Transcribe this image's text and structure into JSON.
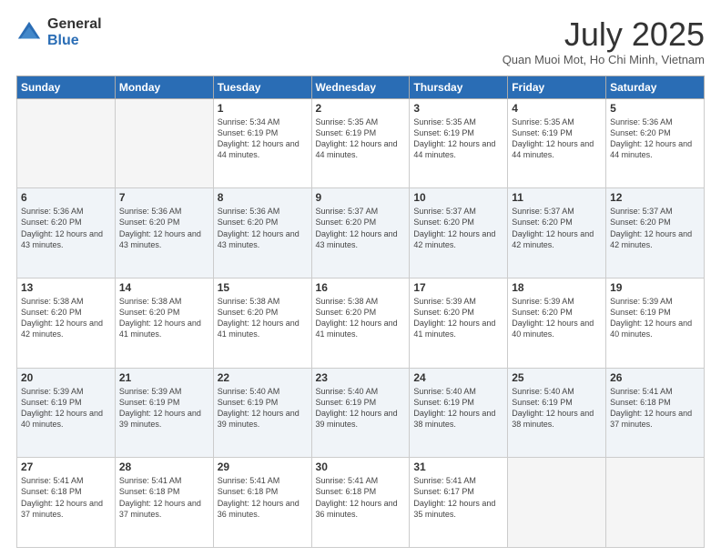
{
  "logo": {
    "general": "General",
    "blue": "Blue"
  },
  "title": "July 2025",
  "subtitle": "Quan Muoi Mot, Ho Chi Minh, Vietnam",
  "weekdays": [
    "Sunday",
    "Monday",
    "Tuesday",
    "Wednesday",
    "Thursday",
    "Friday",
    "Saturday"
  ],
  "weeks": [
    [
      {
        "day": "",
        "info": ""
      },
      {
        "day": "",
        "info": ""
      },
      {
        "day": "1",
        "info": "Sunrise: 5:34 AM\nSunset: 6:19 PM\nDaylight: 12 hours and 44 minutes."
      },
      {
        "day": "2",
        "info": "Sunrise: 5:35 AM\nSunset: 6:19 PM\nDaylight: 12 hours and 44 minutes."
      },
      {
        "day": "3",
        "info": "Sunrise: 5:35 AM\nSunset: 6:19 PM\nDaylight: 12 hours and 44 minutes."
      },
      {
        "day": "4",
        "info": "Sunrise: 5:35 AM\nSunset: 6:19 PM\nDaylight: 12 hours and 44 minutes."
      },
      {
        "day": "5",
        "info": "Sunrise: 5:36 AM\nSunset: 6:20 PM\nDaylight: 12 hours and 44 minutes."
      }
    ],
    [
      {
        "day": "6",
        "info": "Sunrise: 5:36 AM\nSunset: 6:20 PM\nDaylight: 12 hours and 43 minutes."
      },
      {
        "day": "7",
        "info": "Sunrise: 5:36 AM\nSunset: 6:20 PM\nDaylight: 12 hours and 43 minutes."
      },
      {
        "day": "8",
        "info": "Sunrise: 5:36 AM\nSunset: 6:20 PM\nDaylight: 12 hours and 43 minutes."
      },
      {
        "day": "9",
        "info": "Sunrise: 5:37 AM\nSunset: 6:20 PM\nDaylight: 12 hours and 43 minutes."
      },
      {
        "day": "10",
        "info": "Sunrise: 5:37 AM\nSunset: 6:20 PM\nDaylight: 12 hours and 42 minutes."
      },
      {
        "day": "11",
        "info": "Sunrise: 5:37 AM\nSunset: 6:20 PM\nDaylight: 12 hours and 42 minutes."
      },
      {
        "day": "12",
        "info": "Sunrise: 5:37 AM\nSunset: 6:20 PM\nDaylight: 12 hours and 42 minutes."
      }
    ],
    [
      {
        "day": "13",
        "info": "Sunrise: 5:38 AM\nSunset: 6:20 PM\nDaylight: 12 hours and 42 minutes."
      },
      {
        "day": "14",
        "info": "Sunrise: 5:38 AM\nSunset: 6:20 PM\nDaylight: 12 hours and 41 minutes."
      },
      {
        "day": "15",
        "info": "Sunrise: 5:38 AM\nSunset: 6:20 PM\nDaylight: 12 hours and 41 minutes."
      },
      {
        "day": "16",
        "info": "Sunrise: 5:38 AM\nSunset: 6:20 PM\nDaylight: 12 hours and 41 minutes."
      },
      {
        "day": "17",
        "info": "Sunrise: 5:39 AM\nSunset: 6:20 PM\nDaylight: 12 hours and 41 minutes."
      },
      {
        "day": "18",
        "info": "Sunrise: 5:39 AM\nSunset: 6:20 PM\nDaylight: 12 hours and 40 minutes."
      },
      {
        "day": "19",
        "info": "Sunrise: 5:39 AM\nSunset: 6:19 PM\nDaylight: 12 hours and 40 minutes."
      }
    ],
    [
      {
        "day": "20",
        "info": "Sunrise: 5:39 AM\nSunset: 6:19 PM\nDaylight: 12 hours and 40 minutes."
      },
      {
        "day": "21",
        "info": "Sunrise: 5:39 AM\nSunset: 6:19 PM\nDaylight: 12 hours and 39 minutes."
      },
      {
        "day": "22",
        "info": "Sunrise: 5:40 AM\nSunset: 6:19 PM\nDaylight: 12 hours and 39 minutes."
      },
      {
        "day": "23",
        "info": "Sunrise: 5:40 AM\nSunset: 6:19 PM\nDaylight: 12 hours and 39 minutes."
      },
      {
        "day": "24",
        "info": "Sunrise: 5:40 AM\nSunset: 6:19 PM\nDaylight: 12 hours and 38 minutes."
      },
      {
        "day": "25",
        "info": "Sunrise: 5:40 AM\nSunset: 6:19 PM\nDaylight: 12 hours and 38 minutes."
      },
      {
        "day": "26",
        "info": "Sunrise: 5:41 AM\nSunset: 6:18 PM\nDaylight: 12 hours and 37 minutes."
      }
    ],
    [
      {
        "day": "27",
        "info": "Sunrise: 5:41 AM\nSunset: 6:18 PM\nDaylight: 12 hours and 37 minutes."
      },
      {
        "day": "28",
        "info": "Sunrise: 5:41 AM\nSunset: 6:18 PM\nDaylight: 12 hours and 37 minutes."
      },
      {
        "day": "29",
        "info": "Sunrise: 5:41 AM\nSunset: 6:18 PM\nDaylight: 12 hours and 36 minutes."
      },
      {
        "day": "30",
        "info": "Sunrise: 5:41 AM\nSunset: 6:18 PM\nDaylight: 12 hours and 36 minutes."
      },
      {
        "day": "31",
        "info": "Sunrise: 5:41 AM\nSunset: 6:17 PM\nDaylight: 12 hours and 35 minutes."
      },
      {
        "day": "",
        "info": ""
      },
      {
        "day": "",
        "info": ""
      }
    ]
  ]
}
